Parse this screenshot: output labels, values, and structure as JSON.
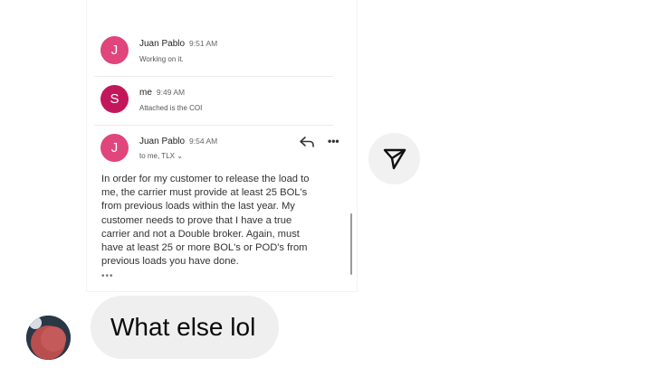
{
  "email": {
    "messages": [
      {
        "initial": "J",
        "sender": "Juan Pablo",
        "time": "9:51 AM",
        "snippet": "Working on it.",
        "avatar_color": "#e0457b"
      },
      {
        "initial": "S",
        "sender": "me",
        "time": "9:49 AM",
        "snippet": "Attached is the COI",
        "avatar_color": "#c2185b"
      },
      {
        "initial": "J",
        "sender": "Juan Pablo",
        "time": "9:54 AM",
        "to": "to me, TLX ⌄",
        "body": "In order for my customer to release the load to\nme, the carrier must provide at least 25 BOL's\nfrom previous loads within the last year. My\ncustomer needs to prove that I have a true\ncarrier and not a Double broker. Again, must\nhave at least 25 or more BOL's or POD's from\nprevious loads you have done.",
        "more": "•••",
        "avatar_color": "#e0457b"
      }
    ],
    "icons": {
      "reply": "reply-icon",
      "more": "more-horizontal-icon"
    }
  },
  "share_button": {
    "icon": "share-send-icon"
  },
  "chat": {
    "message": "What else lol",
    "bubble_color": "#efefef",
    "avatar": "user-avatar"
  }
}
